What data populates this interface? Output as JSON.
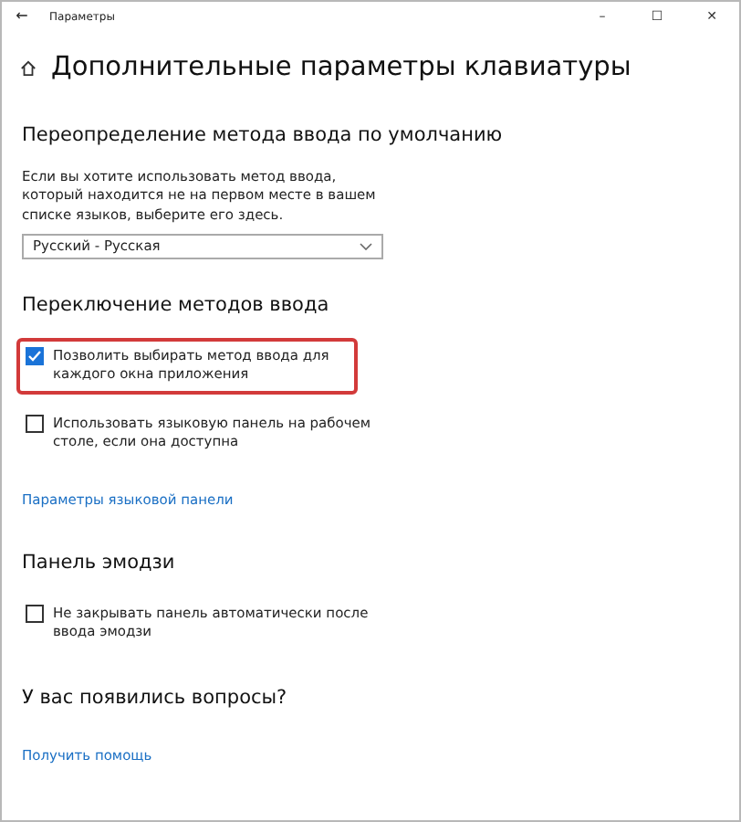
{
  "window": {
    "title": "Параметры",
    "back": "←",
    "controls": [
      "–",
      "☐",
      "✕"
    ]
  },
  "page_title": "Дополнительные параметры клавиатуры",
  "sections": [
    {
      "heading": "Переопределение метода ввода по умолчанию",
      "items": [
        {
          "kind": "text",
          "text": "Если вы хотите использовать метод ввода, который находится не на первом месте в вашем списке языков, выберите его здесь."
        },
        {
          "kind": "dropdown",
          "value": "Русский - Русская"
        }
      ]
    },
    {
      "heading": "Переключение методов ввода",
      "items": [
        {
          "kind": "checkbox",
          "label": "Позволить выбирать метод ввода для каждого окна приложения",
          "checked": true,
          "highlighted": true
        },
        {
          "kind": "checkbox",
          "label": "Использовать языковую панель на рабочем столе, если она доступна",
          "checked": false,
          "highlighted": false
        },
        {
          "kind": "link",
          "text": "Параметры языковой панели"
        }
      ]
    },
    {
      "heading": "Панель эмодзи",
      "items": [
        {
          "kind": "checkbox",
          "label": "Не закрывать панель автоматически после ввода эмодзи",
          "checked": false,
          "highlighted": false
        }
      ]
    },
    {
      "heading": "У вас появились вопросы?",
      "items": [
        {
          "kind": "link",
          "text": "Получить помощь"
        }
      ]
    }
  ]
}
